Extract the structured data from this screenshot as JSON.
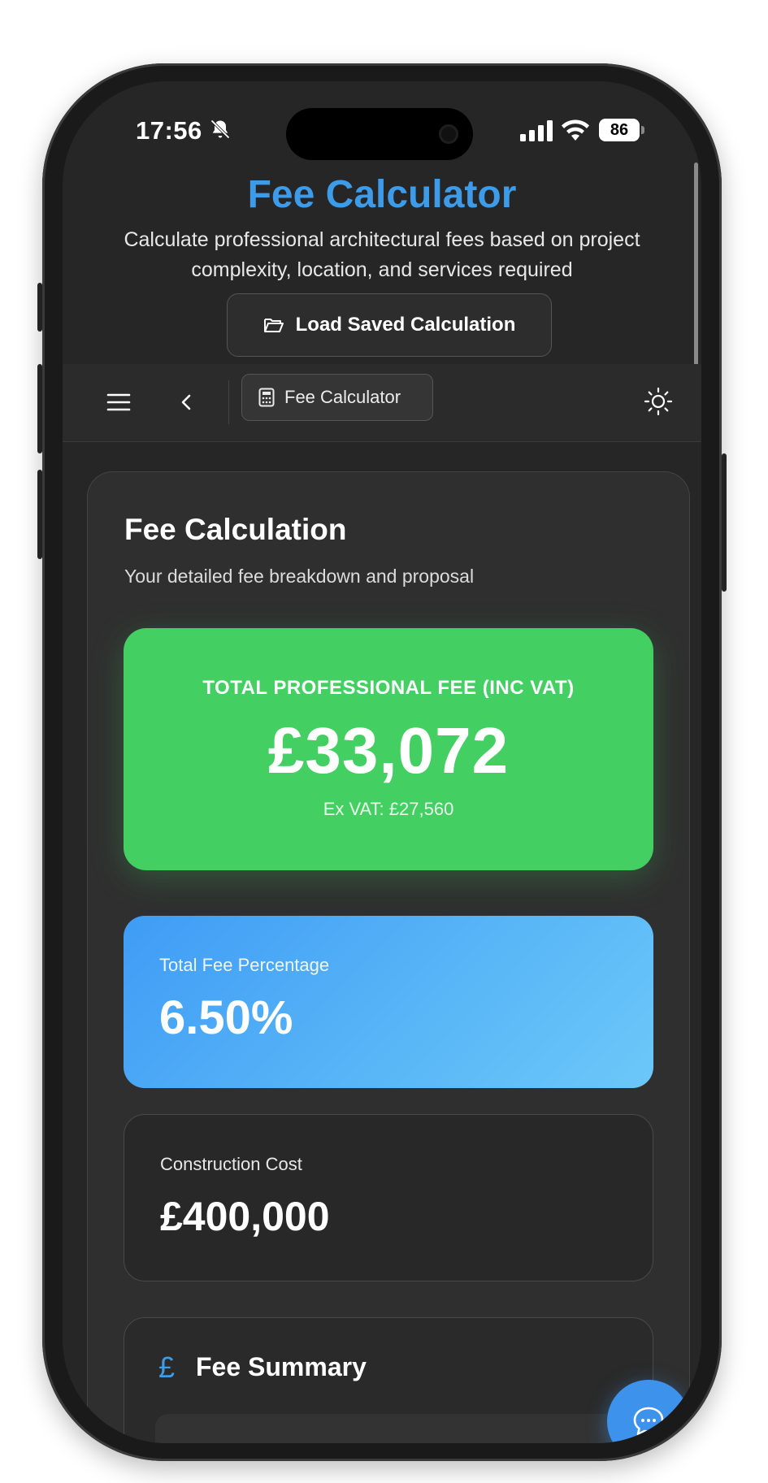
{
  "status_bar": {
    "time": "17:56",
    "battery": "86",
    "icons": [
      "bell-muted-icon",
      "signal-icon",
      "wifi-icon",
      "battery-icon"
    ]
  },
  "header": {
    "title": "Fee Calculator",
    "subtitle": "Calculate professional architectural fees based on project complexity, location, and services required",
    "load_button": "Load Saved Calculation"
  },
  "toolbar": {
    "active_tab": "Fee Calculator",
    "icons": [
      "menu-icon",
      "back-icon",
      "calculator-icon",
      "sun-icon"
    ]
  },
  "card": {
    "title": "Fee Calculation",
    "subtitle": "Your detailed fee breakdown and proposal",
    "total": {
      "label": "TOTAL PROFESSIONAL FEE (INC VAT)",
      "value": "£33,072",
      "ex_vat": "Ex VAT: £27,560"
    },
    "percentage": {
      "label": "Total Fee Percentage",
      "value": "6.50%"
    },
    "construction": {
      "label": "Construction Cost",
      "value": "£400,000"
    },
    "summary": {
      "icon": "£",
      "title": "Fee Summary"
    }
  },
  "colors": {
    "accent_blue": "#3d9be8",
    "total_green": "#44cf63",
    "background": "#262626"
  }
}
